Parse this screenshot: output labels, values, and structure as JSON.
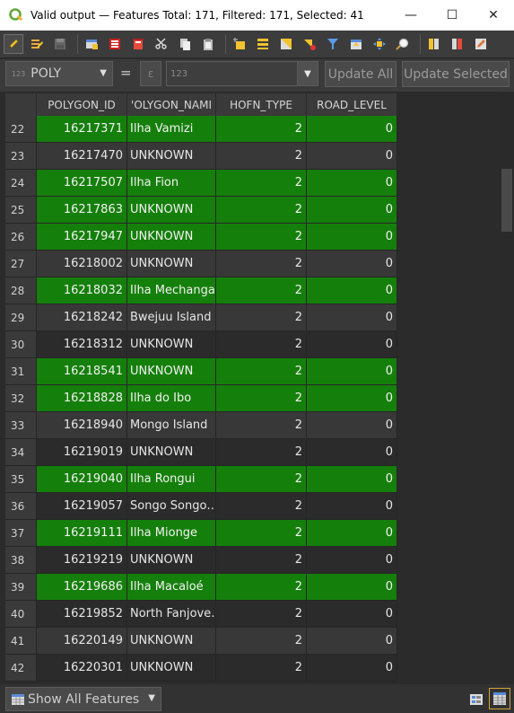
{
  "window": {
    "title": "Valid output — Features Total: 171, Filtered: 171, Selected: 41",
    "minimize": "—",
    "maximize": "☐",
    "close": "✕"
  },
  "toolbar": {
    "icons": [
      "pencil-icon",
      "multi-edit-icon",
      "save-edits-icon",
      "reload-icon",
      "add-feature-icon",
      "delete-feature-icon",
      "cut-icon",
      "copy-icon",
      "paste-icon",
      "select-by-expression-icon",
      "select-all-icon",
      "invert-selection-icon",
      "deselect-all-icon",
      "filter-icon",
      "move-selection-top-icon",
      "pan-to-selection-icon",
      "zoom-to-selection-icon",
      "new-field-icon",
      "delete-field-icon",
      "field-calculator-icon"
    ]
  },
  "calc_bar": {
    "field_value": "POLY",
    "field_icon_text": "123",
    "equals": "=",
    "expression_icon": "ε",
    "expression_placeholder": "123",
    "update_all": "Update All",
    "update_selected": "Update Selected"
  },
  "table": {
    "columns": [
      "POLYGON_ID",
      "'OLYGON_NAMI",
      "HOFN_TYPE",
      "ROAD_LEVEL"
    ],
    "rows": [
      {
        "n": "22",
        "id": "16217371",
        "name": "Ilha Vamizi",
        "hofn": "2",
        "road": "0",
        "selected": true
      },
      {
        "n": "23",
        "id": "16217470",
        "name": "UNKNOWN",
        "hofn": "2",
        "road": "0",
        "selected": false
      },
      {
        "n": "24",
        "id": "16217507",
        "name": "Ilha Fion",
        "hofn": "2",
        "road": "0",
        "selected": true
      },
      {
        "n": "25",
        "id": "16217863",
        "name": "UNKNOWN",
        "hofn": "2",
        "road": "0",
        "selected": true
      },
      {
        "n": "26",
        "id": "16217947",
        "name": "UNKNOWN",
        "hofn": "2",
        "road": "0",
        "selected": true
      },
      {
        "n": "27",
        "id": "16218002",
        "name": "UNKNOWN",
        "hofn": "2",
        "road": "0",
        "selected": false
      },
      {
        "n": "28",
        "id": "16218032",
        "name": "Ilha Mechanga",
        "hofn": "2",
        "road": "0",
        "selected": true
      },
      {
        "n": "29",
        "id": "16218242",
        "name": "Bwejuu Island",
        "hofn": "2",
        "road": "0",
        "selected": false
      },
      {
        "n": "30",
        "id": "16218312",
        "name": "UNKNOWN",
        "hofn": "2",
        "road": "0",
        "selected": false
      },
      {
        "n": "31",
        "id": "16218541",
        "name": "UNKNOWN",
        "hofn": "2",
        "road": "0",
        "selected": true
      },
      {
        "n": "32",
        "id": "16218828",
        "name": "Ilha do Ibo",
        "hofn": "2",
        "road": "0",
        "selected": true
      },
      {
        "n": "33",
        "id": "16218940",
        "name": "Mongo Island",
        "hofn": "2",
        "road": "0",
        "selected": false
      },
      {
        "n": "34",
        "id": "16219019",
        "name": "UNKNOWN",
        "hofn": "2",
        "road": "0",
        "selected": false
      },
      {
        "n": "35",
        "id": "16219040",
        "name": "Ilha Rongui",
        "hofn": "2",
        "road": "0",
        "selected": true
      },
      {
        "n": "36",
        "id": "16219057",
        "name": "Songo Songo…",
        "hofn": "2",
        "road": "0",
        "selected": false
      },
      {
        "n": "37",
        "id": "16219111",
        "name": "Ilha Mionge",
        "hofn": "2",
        "road": "0",
        "selected": true
      },
      {
        "n": "38",
        "id": "16219219",
        "name": "UNKNOWN",
        "hofn": "2",
        "road": "0",
        "selected": false
      },
      {
        "n": "39",
        "id": "16219686",
        "name": "Ilha Macaloé",
        "hofn": "2",
        "road": "0",
        "selected": true
      },
      {
        "n": "40",
        "id": "16219852",
        "name": "North Fanjove…",
        "hofn": "2",
        "road": "0",
        "selected": false
      },
      {
        "n": "41",
        "id": "16220149",
        "name": "UNKNOWN",
        "hofn": "2",
        "road": "0",
        "selected": false
      },
      {
        "n": "42",
        "id": "16220301",
        "name": "UNKNOWN",
        "hofn": "2",
        "road": "0",
        "selected": false
      }
    ]
  },
  "bottom": {
    "show_features": "Show All Features"
  },
  "colors": {
    "selected_row": "#157f0b",
    "active_view_border": "#d7a436"
  }
}
